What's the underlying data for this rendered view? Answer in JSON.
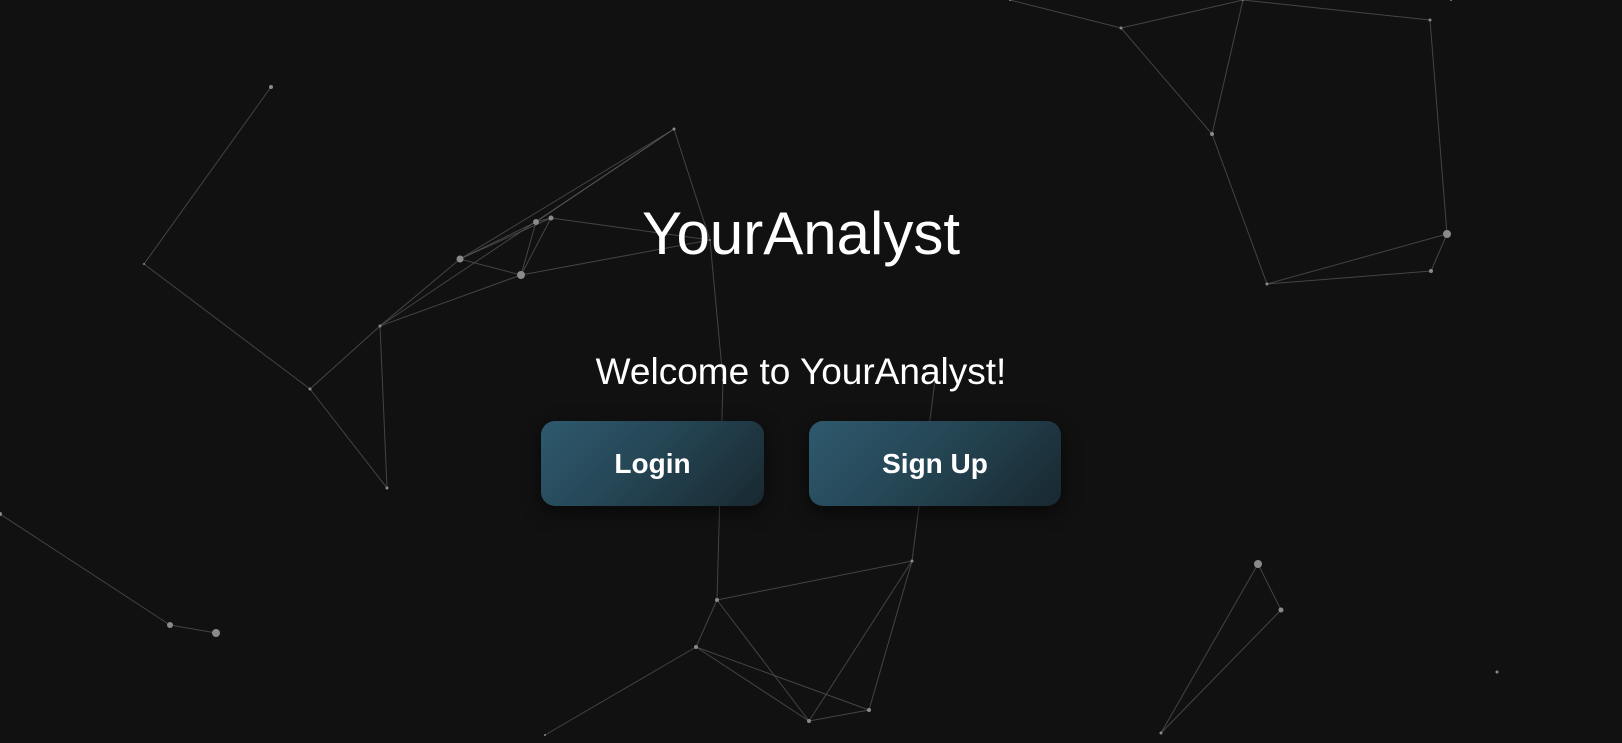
{
  "app": {
    "title": "YourAnalyst",
    "welcome": "Welcome to YourAnalyst!"
  },
  "actions": {
    "login_label": "Login",
    "signup_label": "Sign Up"
  },
  "theme": {
    "background": "#111111",
    "button_gradient_start": "#2e5a6e",
    "button_gradient_end": "#182830",
    "text": "#ffffff"
  }
}
